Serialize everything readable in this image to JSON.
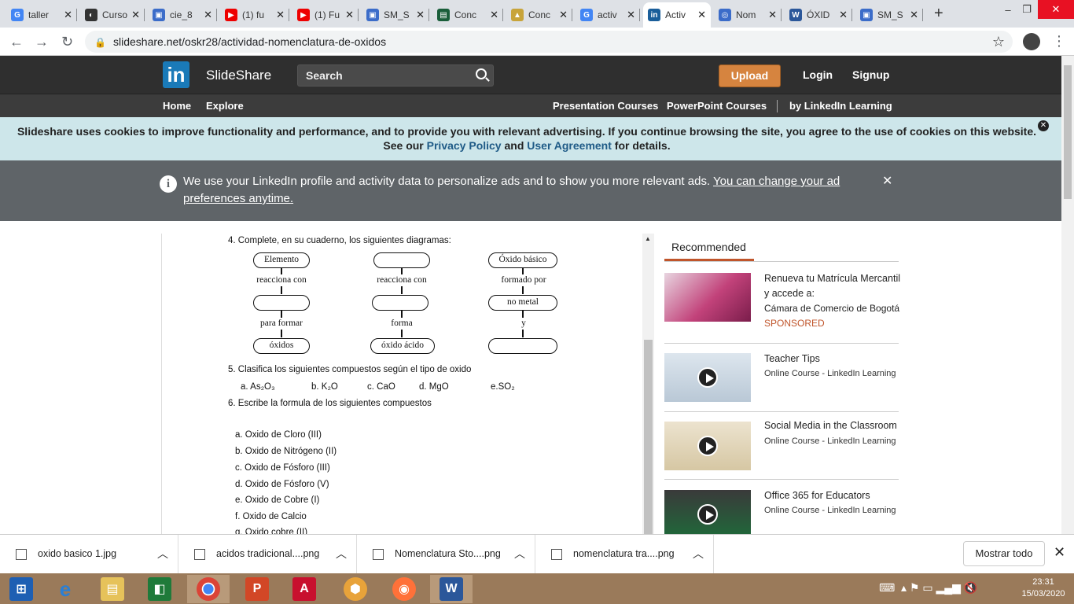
{
  "browser": {
    "tabs": [
      {
        "label": "taller",
        "fav": "G",
        "color": "#4285f4"
      },
      {
        "label": "Curso",
        "fav": "◐",
        "color": "#333"
      },
      {
        "label": "cie_8",
        "fav": "▣",
        "color": "#3b6cc9"
      },
      {
        "label": "(1) fu",
        "fav": "▶",
        "color": "#e00"
      },
      {
        "label": "(1) Fu",
        "fav": "▶",
        "color": "#e00"
      },
      {
        "label": "SM_S",
        "fav": "▣",
        "color": "#3b6cc9"
      },
      {
        "label": "Conc",
        "fav": "▤",
        "color": "#1a5e3a"
      },
      {
        "label": "Conc",
        "fav": "▲",
        "color": "#c8a43a"
      },
      {
        "label": "activ",
        "fav": "G",
        "color": "#4285f4"
      },
      {
        "label": "Activ",
        "fav": "in",
        "color": "#1a5e9a"
      },
      {
        "label": "Nom",
        "fav": "◎",
        "color": "#3b6cc9"
      },
      {
        "label": "ÓXID",
        "fav": "W",
        "color": "#2b579a"
      },
      {
        "label": "SM_S",
        "fav": "▣",
        "color": "#3b6cc9"
      }
    ],
    "url": "slideshare.net/oskr28/actividad-nomenclatura-de-oxidos"
  },
  "header": {
    "logo_mark": "in",
    "logo_text": "SlideShare",
    "search_placeholder": "Search",
    "upload": "Upload",
    "login": "Login",
    "signup": "Signup"
  },
  "subnav": {
    "home": "Home",
    "explore": "Explore",
    "presentation": "Presentation Courses",
    "powerpoint": "PowerPoint Courses",
    "linkedin": "by LinkedIn Learning"
  },
  "cookie": {
    "text1": "Slideshare uses cookies to improve functionality and performance, and to provide you with relevant advertising. If you continue browsing the site, you agree to the use of cookies on this website. See our",
    "privacy": "Privacy Policy",
    "and": "and",
    "agreement": "User Agreement",
    "tail": "for details."
  },
  "adnotice": {
    "text": "We use your LinkedIn profile and activity data to personalize ads and to show you more relevant ads.",
    "link": "You can change your ad preferences anytime."
  },
  "slide": {
    "q4": "4.  Complete, en su cuaderno, los siguientes diagramas:",
    "diag1": {
      "top": "Elemento",
      "l1": "reacciona con",
      "l2": "para formar",
      "bottom": "óxidos"
    },
    "diag2": {
      "top": "",
      "l1": "reacciona con",
      "l2": "forma",
      "bottom": "óxido ácido"
    },
    "diag3": {
      "top": "Óxido básico",
      "l1": "formado por",
      "mid": "no metal",
      "l2": "y",
      "bottom": ""
    },
    "q5": "5. Clasifica los siguientes compuestos según el tipo de oxido",
    "q5_items": [
      "a. As₂O₃",
      "b. K₂O",
      "c. CaO",
      "d. MgO",
      "e.SO₂"
    ],
    "q6": "6. Escribe la formula de los siguientes compuestos",
    "q6_items": [
      "a.  Oxido de Cloro (III)",
      "b.  Oxido de Nitrógeno (II)",
      "c.  Oxido de Fósforo (III)",
      "d.  Oxido de Fósforo (V)",
      "e.  Oxido de Cobre (I)",
      "f.  Oxido de Calcio",
      "g.  Oxido cobre (II)"
    ]
  },
  "recommended": {
    "title": "Recommended",
    "items": [
      {
        "title": "Renueva tu Matrícula Mercantil y accede a:",
        "sub": "Cámara de Comercio de Bogotá",
        "badge": "SPONSORED"
      },
      {
        "title": "Teacher Tips",
        "sub": "Online Course - LinkedIn Learning"
      },
      {
        "title": "Social Media in the Classroom",
        "sub": "Online Course - LinkedIn Learning"
      },
      {
        "title": "Office 365 for Educators",
        "sub": "Online Course - LinkedIn Learning"
      }
    ]
  },
  "downloads": {
    "items": [
      "oxido basico 1.jpg",
      "acidos tradicional....png",
      "Nomenclatura Sto....png",
      "nomenclatura tra....png"
    ],
    "show_all": "Mostrar todo"
  },
  "taskbar": {
    "time": "23:31",
    "date": "15/03/2020"
  }
}
